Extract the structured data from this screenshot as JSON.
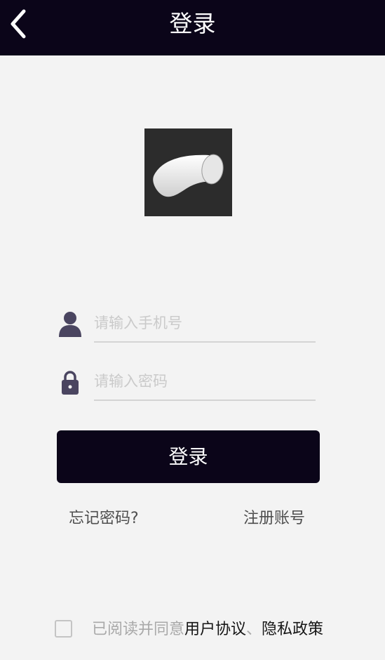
{
  "header": {
    "title": "登录",
    "back_icon": "chevron-left-icon"
  },
  "logo": {
    "icon": "pipe-elbow-logo"
  },
  "phone": {
    "placeholder": "请输入手机号",
    "value": "",
    "icon": "user-icon"
  },
  "password": {
    "placeholder": "请输入密码",
    "value": "",
    "icon": "lock-icon"
  },
  "login_button": {
    "label": "登录"
  },
  "links": {
    "forgot": "忘记密码?",
    "register": "注册账号"
  },
  "agreement": {
    "checked": false,
    "prefix": "已阅读并同意",
    "terms": "用户协议",
    "separator": "、",
    "privacy": "隐私政策"
  },
  "colors": {
    "header_bg": "#0b0519",
    "button_bg": "#0b0519",
    "page_bg": "#f3f3f3",
    "icon": "#4a4560"
  }
}
